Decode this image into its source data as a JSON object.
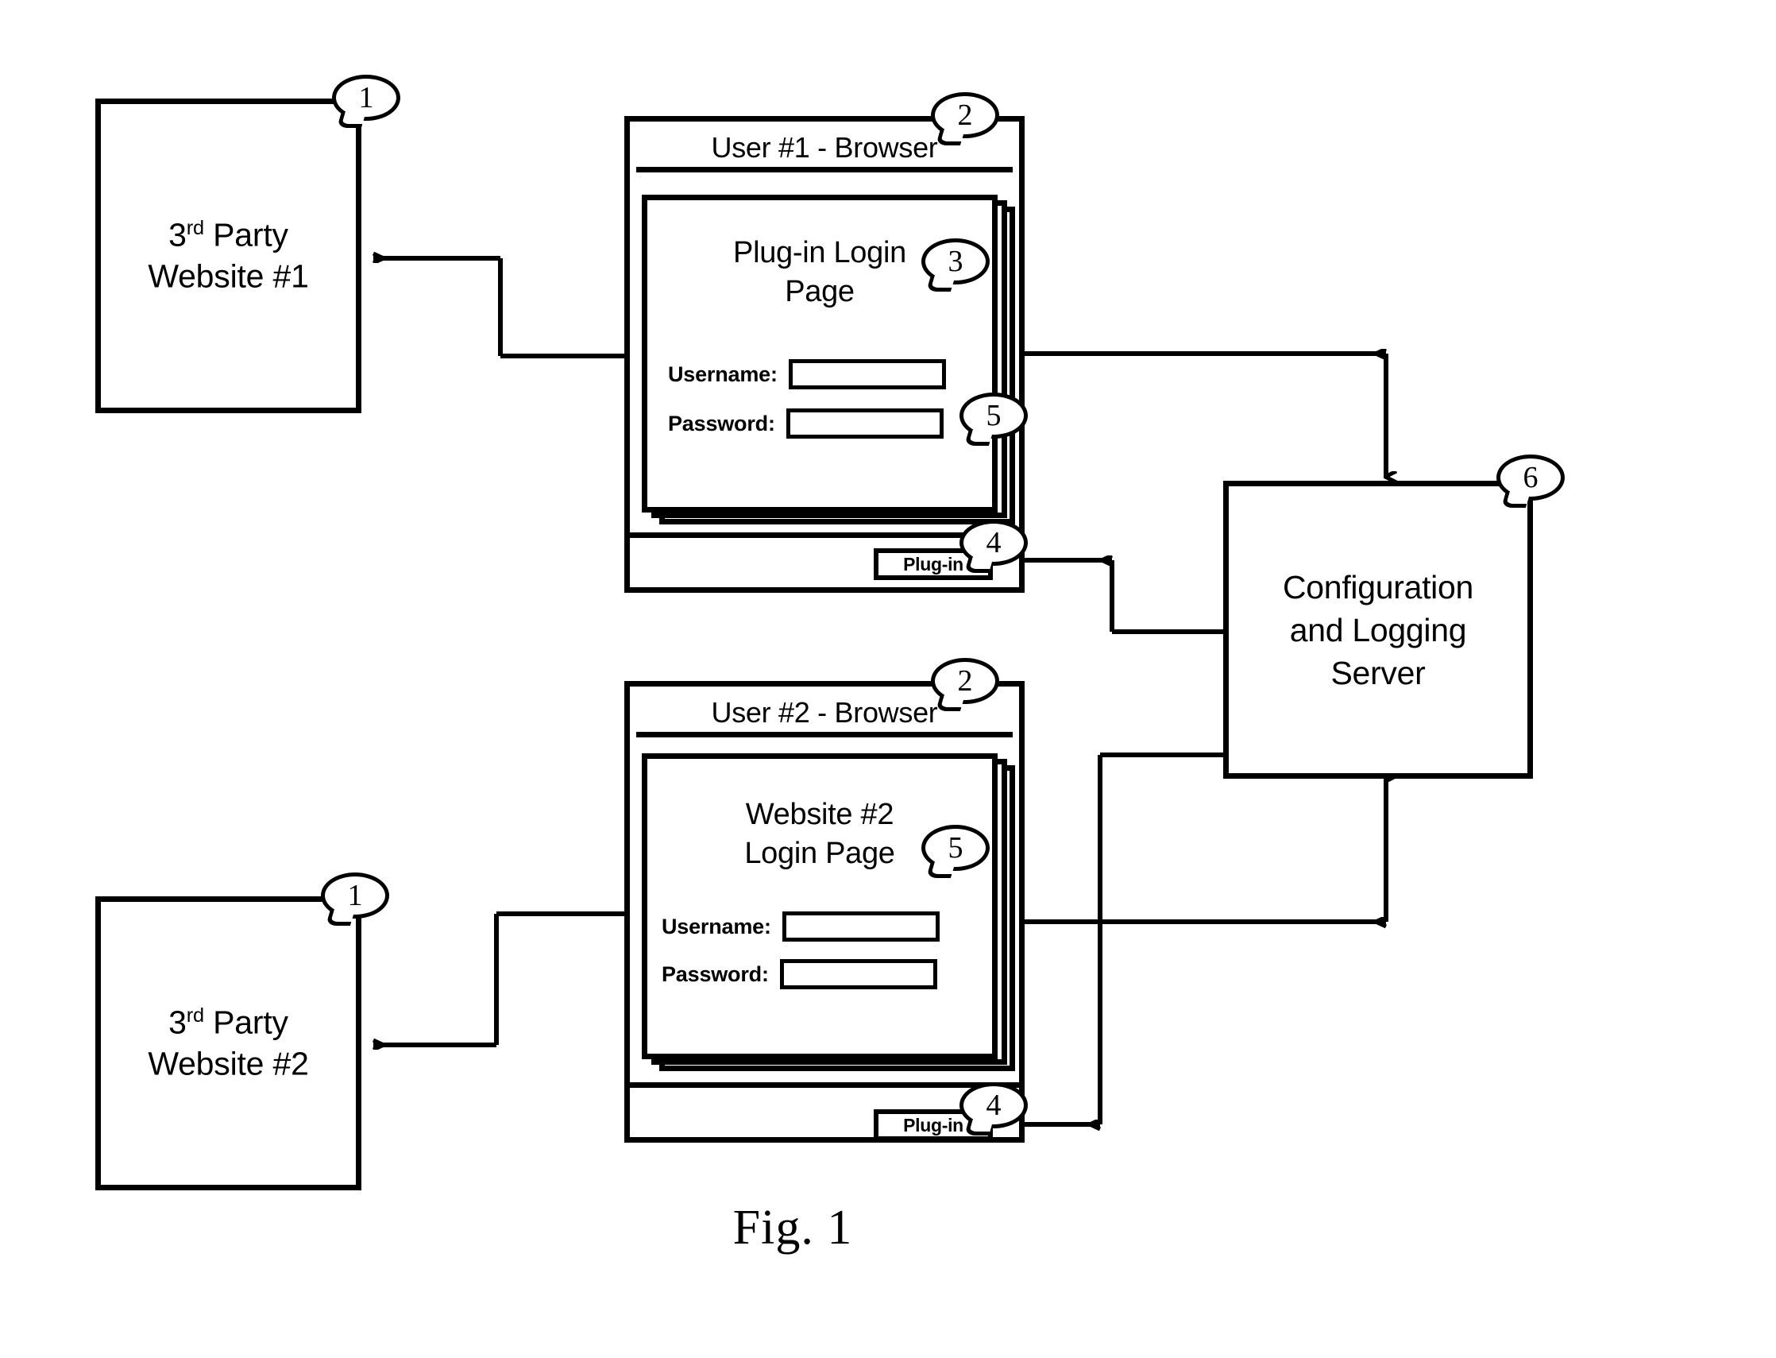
{
  "figure": {
    "caption": "Fig. 1"
  },
  "callouts": [
    {
      "id": "callout-1-top",
      "number": "1"
    },
    {
      "id": "callout-2-top",
      "number": "2"
    },
    {
      "id": "callout-3",
      "number": "3"
    },
    {
      "id": "callout-5-top",
      "number": "5"
    },
    {
      "id": "callout-4-top",
      "number": "4"
    },
    {
      "id": "callout-6",
      "number": "6"
    },
    {
      "id": "callout-2-bottom",
      "number": "2"
    },
    {
      "id": "callout-5-bottom",
      "number": "5"
    },
    {
      "id": "callout-4-bottom",
      "number": "4"
    },
    {
      "id": "callout-1-bottom",
      "number": "1"
    }
  ],
  "third_party_sites": [
    {
      "id": "third-party-website-1",
      "line1_prefix": "3",
      "line1_sup": "rd",
      "line1_suffix": " Party",
      "line2": "Website #1",
      "callout": "1"
    },
    {
      "id": "third-party-website-2",
      "line1_prefix": "3",
      "line1_sup": "rd",
      "line1_suffix": " Party",
      "line2": "Website #2",
      "callout": "1"
    }
  ],
  "browsers": [
    {
      "id": "browser-user-1",
      "title": "User #1 - Browser",
      "page_title_line1": "Plug-in Login",
      "page_title_line2": "Page",
      "username_label": "Username:",
      "password_label": "Password:",
      "username_value": "",
      "password_value": "",
      "plugin_button_label": "Plug-in",
      "title_callout": "2",
      "page_callout": "3",
      "form_callout": "5",
      "plugin_callout": "4"
    },
    {
      "id": "browser-user-2",
      "title": "User #2 - Browser",
      "page_title_line1": "Website #2",
      "page_title_line2": "Login Page",
      "username_label": "Username:",
      "password_label": "Password:",
      "username_value": "",
      "password_value": "",
      "plugin_button_label": "Plug-in",
      "title_callout": "2",
      "page_callout": "5",
      "plugin_callout": "4"
    }
  ],
  "server": {
    "id": "configuration-and-logging-server",
    "line1": "Configuration",
    "line2": "and Logging",
    "line3": "Server",
    "callout": "6"
  },
  "colors": {
    "stroke": "#000000",
    "background": "#ffffff"
  }
}
